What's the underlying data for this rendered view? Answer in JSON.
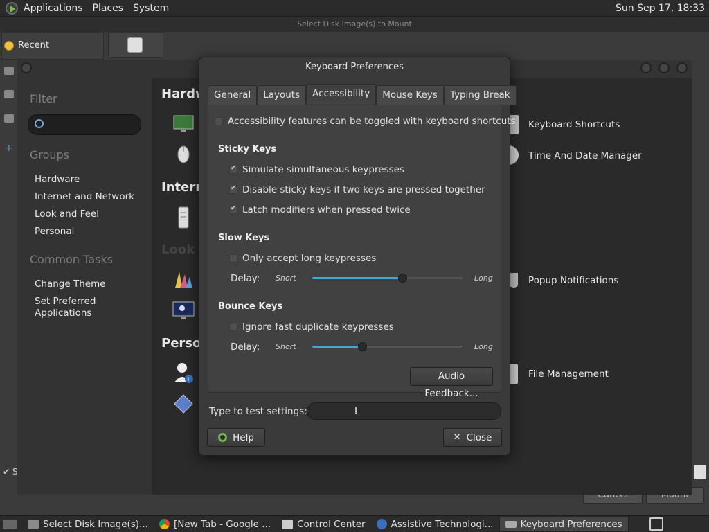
{
  "top_panel": {
    "menus": [
      "Applications",
      "Places",
      "System"
    ],
    "clock": "Sun Sep 17, 18:33"
  },
  "file_chooser": {
    "title": "Select Disk Image(s) to Mount",
    "recent": "Recent",
    "cancel": "Cancel",
    "mount": "Mount",
    "show_hidden_prefix": "S"
  },
  "control_center": {
    "filter_heading": "Filter",
    "groups_heading": "Groups",
    "groups": [
      "Hardware",
      "Internet and Network",
      "Look and Feel",
      "Personal"
    ],
    "common_tasks_heading": "Common Tasks",
    "tasks": [
      "Change Theme",
      "Set Preferred Applications"
    ],
    "sections": {
      "hardware": "Hardw",
      "internet": "Intern",
      "look": "Look",
      "personal": "Perso"
    },
    "right_items": {
      "keyboard_shortcuts": "Keyboard Shortcuts",
      "time_date": "Time And Date Manager",
      "popup_notifications": "Popup Notifications",
      "file_management": "File Management"
    }
  },
  "dialog": {
    "title": "Keyboard Preferences",
    "tabs": [
      "General",
      "Layouts",
      "Accessibility",
      "Mouse Keys",
      "Typing Break"
    ],
    "active_tab": "Accessibility",
    "toggle_shortcuts": {
      "label": "Accessibility features can be toggled with keyboard shortcuts",
      "checked": false
    },
    "sticky": {
      "title": "Sticky Keys",
      "simulate": "Simulate simultaneous keypresses",
      "disable": "Disable sticky keys if two keys are pressed together",
      "latch": "Latch modifiers when pressed twice"
    },
    "slow": {
      "title": "Slow Keys",
      "only_accept": "Only accept long keypresses",
      "delay_label": "Delay:",
      "short": "Short",
      "long": "Long",
      "value_fraction": 0.6
    },
    "bounce": {
      "title": "Bounce Keys",
      "ignore": "Ignore fast duplicate keypresses",
      "delay_label": "Delay:",
      "short": "Short",
      "long": "Long",
      "value_fraction": 0.33
    },
    "audio_feedback": "Audio Feedback...",
    "test_label": "Type to test settings:",
    "test_value": "",
    "help": "Help",
    "close": "Close"
  },
  "taskbar": {
    "items": [
      "Select Disk Image(s)...",
      "[New Tab - Google ...",
      "Control Center",
      "Assistive Technologi...",
      "Keyboard Preferences"
    ]
  }
}
